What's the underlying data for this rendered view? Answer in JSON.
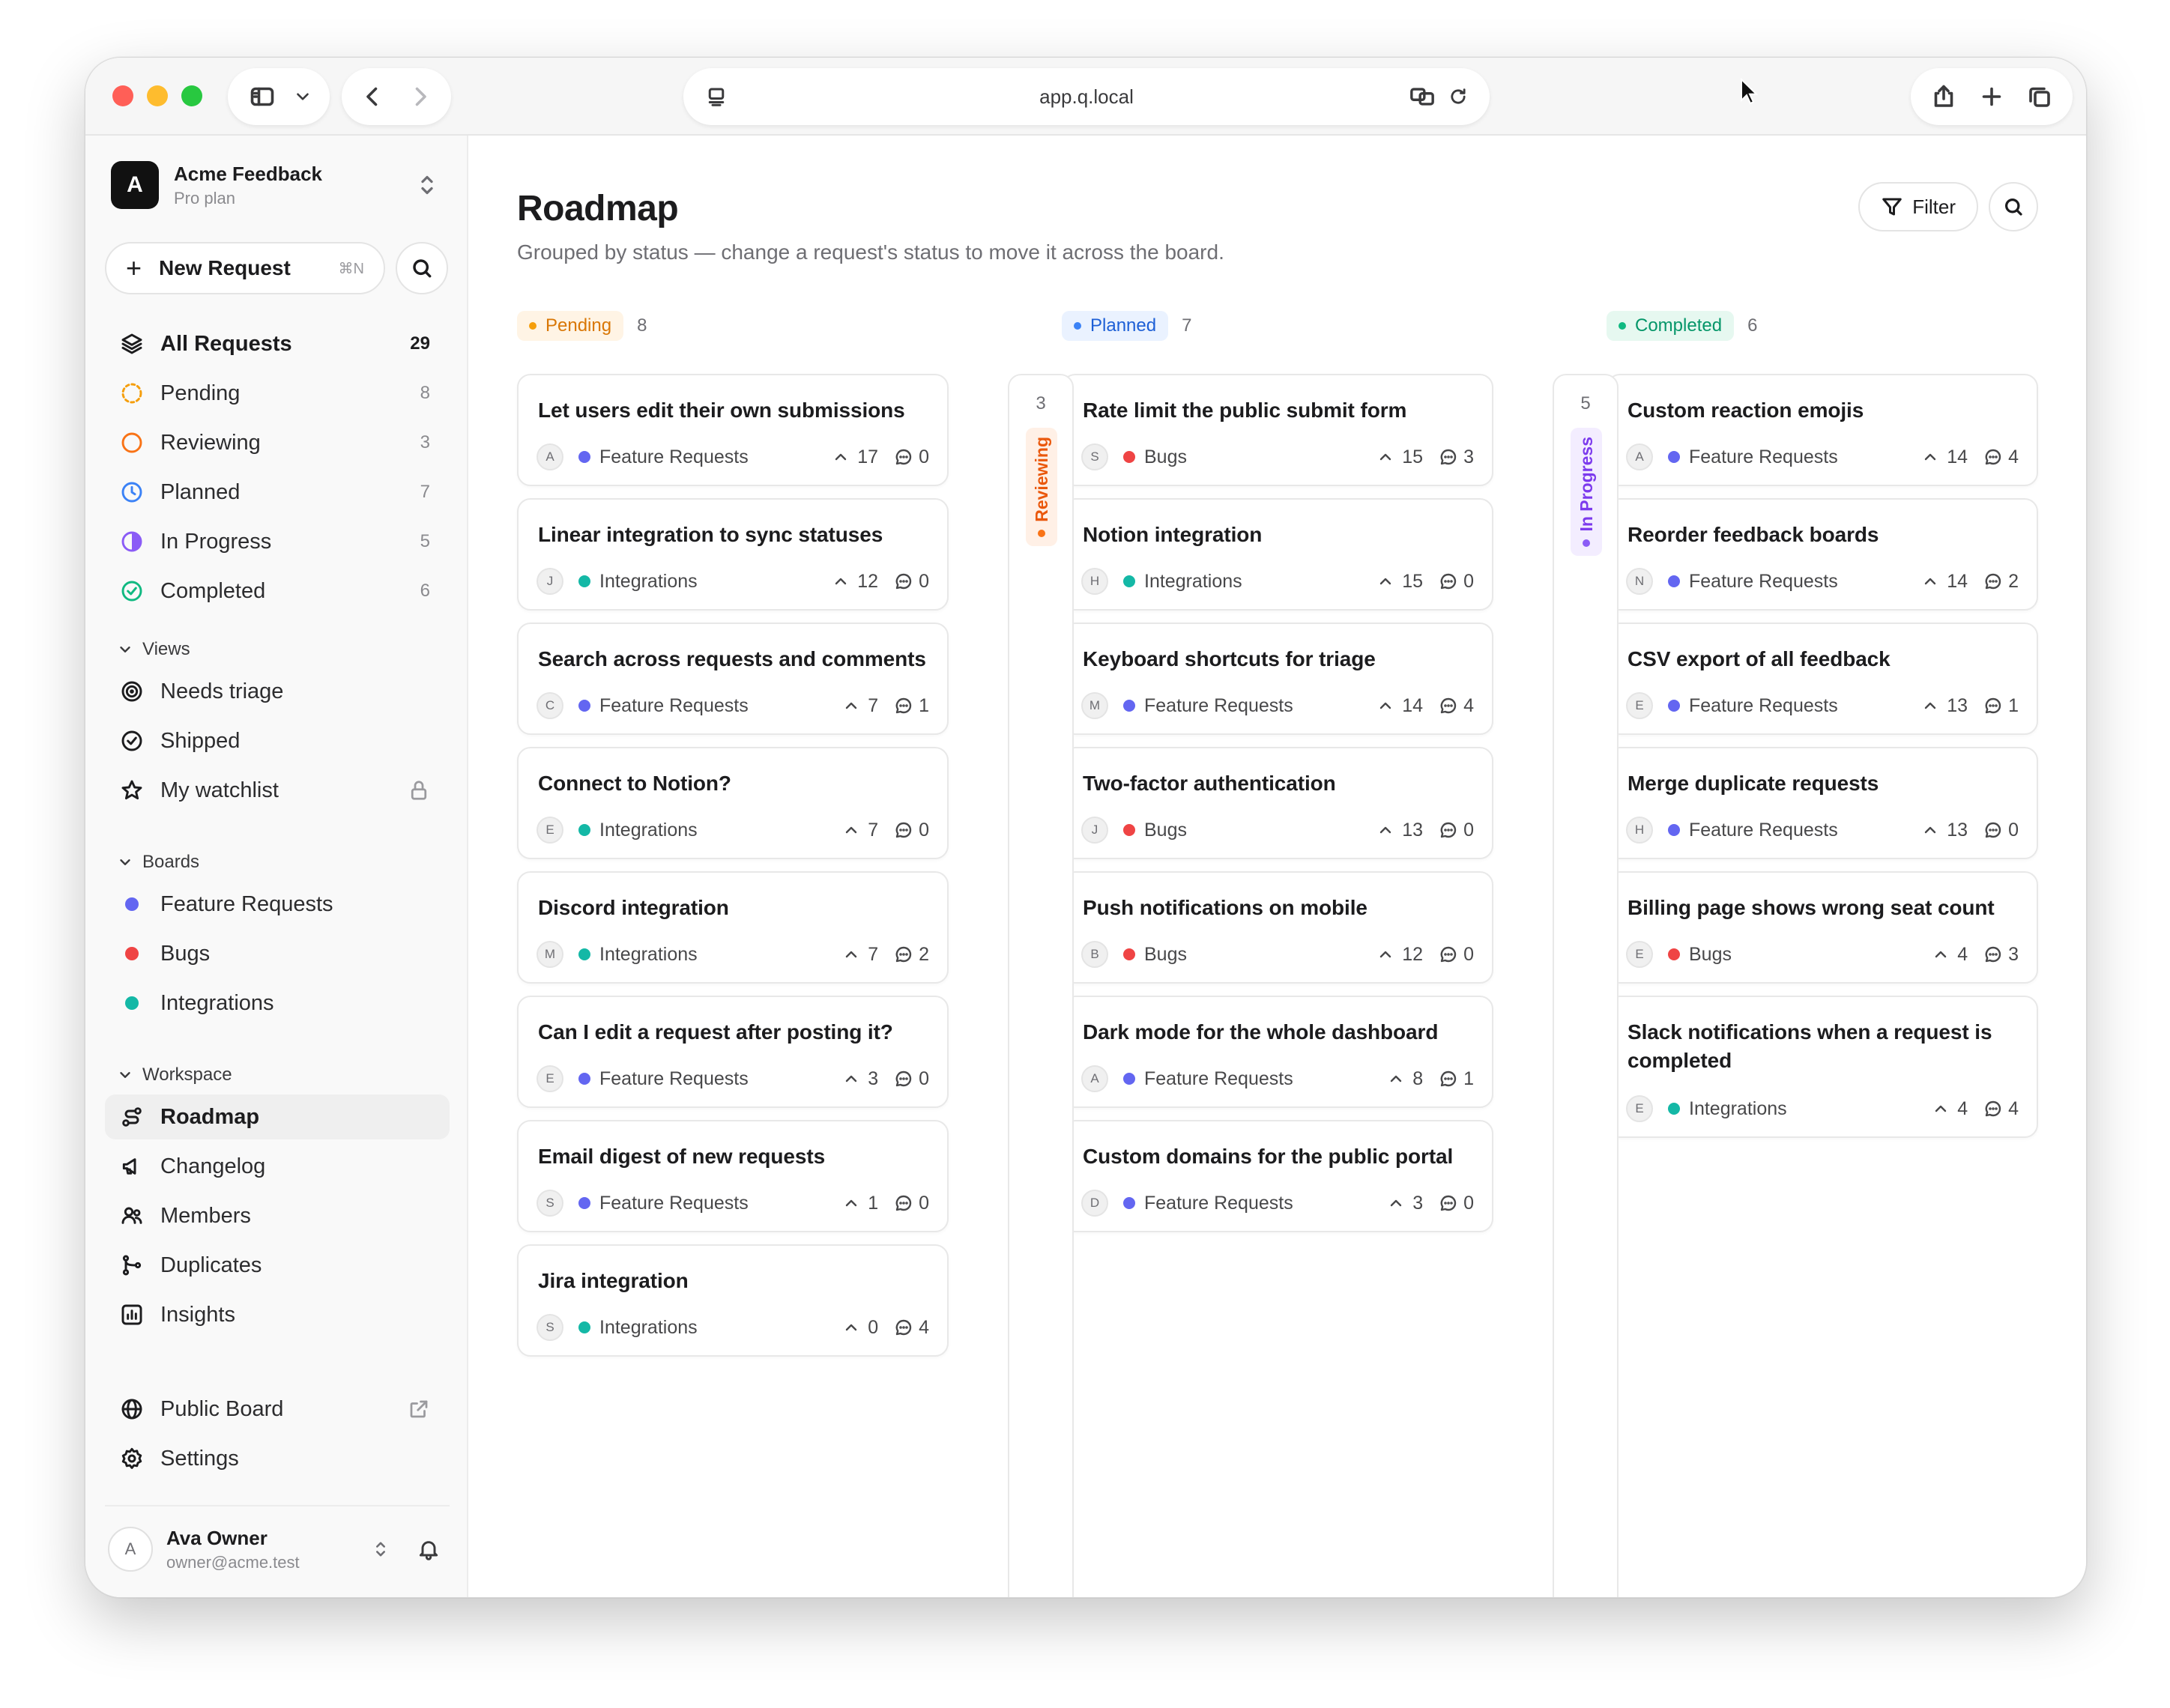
{
  "browser": {
    "url": "app.q.local"
  },
  "workspace": {
    "logo_letter": "A",
    "name": "Acme Feedback",
    "plan": "Pro plan"
  },
  "new_request": {
    "label": "New Request",
    "shortcut": "⌘N"
  },
  "status_nav": [
    {
      "label": "All Requests",
      "count": "29",
      "icon": "layers-icon"
    },
    {
      "label": "Pending",
      "count": "8",
      "icon": "pending-status-icon",
      "color": "#f59e0b"
    },
    {
      "label": "Reviewing",
      "count": "3",
      "icon": "reviewing-status-icon",
      "color": "#f97316"
    },
    {
      "label": "Planned",
      "count": "7",
      "icon": "planned-status-icon",
      "color": "#3b82f6"
    },
    {
      "label": "In Progress",
      "count": "5",
      "icon": "in-progress-status-icon",
      "color": "#8b5cf6"
    },
    {
      "label": "Completed",
      "count": "6",
      "icon": "completed-status-icon",
      "color": "#10b981"
    }
  ],
  "views": {
    "heading": "Views",
    "items": [
      {
        "label": "Needs triage",
        "icon": "triage-icon"
      },
      {
        "label": "Shipped",
        "icon": "check-circle-icon"
      },
      {
        "label": "My watchlist",
        "icon": "star-icon"
      }
    ]
  },
  "boards": {
    "heading": "Boards",
    "items": [
      {
        "label": "Feature Requests",
        "color": "#6366f1"
      },
      {
        "label": "Bugs",
        "color": "#ef4444"
      },
      {
        "label": "Integrations",
        "color": "#14b8a6"
      }
    ]
  },
  "workspace_nav": {
    "heading": "Workspace",
    "items": [
      {
        "label": "Roadmap",
        "icon": "roadmap-icon"
      },
      {
        "label": "Changelog",
        "icon": "megaphone-icon"
      },
      {
        "label": "Members",
        "icon": "members-icon"
      },
      {
        "label": "Duplicates",
        "icon": "merge-icon"
      },
      {
        "label": "Insights",
        "icon": "chart-icon"
      }
    ]
  },
  "footer_nav": [
    {
      "label": "Public Board",
      "icon": "globe-icon"
    },
    {
      "label": "Settings",
      "icon": "gear-icon"
    }
  ],
  "user": {
    "initial": "A",
    "name": "Ava Owner",
    "email": "owner@acme.test"
  },
  "page": {
    "title": "Roadmap",
    "subtitle": "Grouped by status — change a request's status to move it across the board.",
    "filter_label": "Filter"
  },
  "columns": [
    {
      "status": "Pending",
      "count": "8",
      "color": "#f59e0b",
      "bg": "#fff4e5",
      "text": "#d97706",
      "cards": [
        {
          "title": "Let users edit their own submissions",
          "author": "A",
          "board": "Feature Requests",
          "board_color": "#6366f1",
          "votes": "17",
          "comments": "0"
        },
        {
          "title": "Linear integration to sync statuses",
          "author": "J",
          "board": "Integrations",
          "board_color": "#14b8a6",
          "votes": "12",
          "comments": "0"
        },
        {
          "title": "Search across requests and comments",
          "author": "C",
          "board": "Feature Requests",
          "board_color": "#6366f1",
          "votes": "7",
          "comments": "1"
        },
        {
          "title": "Connect to Notion?",
          "author": "E",
          "board": "Integrations",
          "board_color": "#14b8a6",
          "votes": "7",
          "comments": "0"
        },
        {
          "title": "Discord integration",
          "author": "M",
          "board": "Integrations",
          "board_color": "#14b8a6",
          "votes": "7",
          "comments": "2"
        },
        {
          "title": "Can I edit a request after posting it?",
          "author": "E",
          "board": "Feature Requests",
          "board_color": "#6366f1",
          "votes": "3",
          "comments": "0"
        },
        {
          "title": "Email digest of new requests",
          "author": "S",
          "board": "Feature Requests",
          "board_color": "#6366f1",
          "votes": "1",
          "comments": "0"
        },
        {
          "title": "Jira integration",
          "author": "S",
          "board": "Integrations",
          "board_color": "#14b8a6",
          "votes": "0",
          "comments": "4"
        }
      ]
    },
    {
      "status": "Planned",
      "count": "7",
      "color": "#3b82f6",
      "bg": "#eaf2ff",
      "text": "#1d5fd6",
      "cards": [
        {
          "title": "Rate limit the public submit form",
          "author": "S",
          "board": "Bugs",
          "board_color": "#ef4444",
          "votes": "15",
          "comments": "3"
        },
        {
          "title": "Notion integration",
          "author": "H",
          "board": "Integrations",
          "board_color": "#14b8a6",
          "votes": "15",
          "comments": "0"
        },
        {
          "title": "Keyboard shortcuts for triage",
          "author": "M",
          "board": "Feature Requests",
          "board_color": "#6366f1",
          "votes": "14",
          "comments": "4"
        },
        {
          "title": "Two-factor authentication",
          "author": "J",
          "board": "Bugs",
          "board_color": "#ef4444",
          "votes": "13",
          "comments": "0"
        },
        {
          "title": "Push notifications on mobile",
          "author": "B",
          "board": "Bugs",
          "board_color": "#ef4444",
          "votes": "12",
          "comments": "0"
        },
        {
          "title": "Dark mode for the whole dashboard",
          "author": "A",
          "board": "Feature Requests",
          "board_color": "#6366f1",
          "votes": "8",
          "comments": "1"
        },
        {
          "title": "Custom domains for the public portal",
          "author": "D",
          "board": "Feature Requests",
          "board_color": "#6366f1",
          "votes": "3",
          "comments": "0"
        }
      ]
    },
    {
      "status": "Completed",
      "count": "6",
      "color": "#10b981",
      "bg": "#e6f8f0",
      "text": "#059669",
      "cards": [
        {
          "title": "Custom reaction emojis",
          "author": "A",
          "board": "Feature Requests",
          "board_color": "#6366f1",
          "votes": "14",
          "comments": "4"
        },
        {
          "title": "Reorder feedback boards",
          "author": "N",
          "board": "Feature Requests",
          "board_color": "#6366f1",
          "votes": "14",
          "comments": "2"
        },
        {
          "title": "CSV export of all feedback",
          "author": "E",
          "board": "Feature Requests",
          "board_color": "#6366f1",
          "votes": "13",
          "comments": "1"
        },
        {
          "title": "Merge duplicate requests",
          "author": "H",
          "board": "Feature Requests",
          "board_color": "#6366f1",
          "votes": "13",
          "comments": "0"
        },
        {
          "title": "Billing page shows wrong seat count",
          "author": "E",
          "board": "Bugs",
          "board_color": "#ef4444",
          "votes": "4",
          "comments": "3"
        },
        {
          "title": "Slack notifications when a request is completed",
          "author": "E",
          "board": "Integrations",
          "board_color": "#14b8a6",
          "votes": "4",
          "comments": "4"
        }
      ]
    }
  ],
  "collapsed_columns": [
    {
      "status": "Reviewing",
      "count": "3",
      "color": "#f97316",
      "bg": "#fff0e6",
      "text": "#ea580c"
    },
    {
      "status": "In Progress",
      "count": "5",
      "color": "#8b5cf6",
      "bg": "#f3edff",
      "text": "#7c3aed"
    }
  ]
}
